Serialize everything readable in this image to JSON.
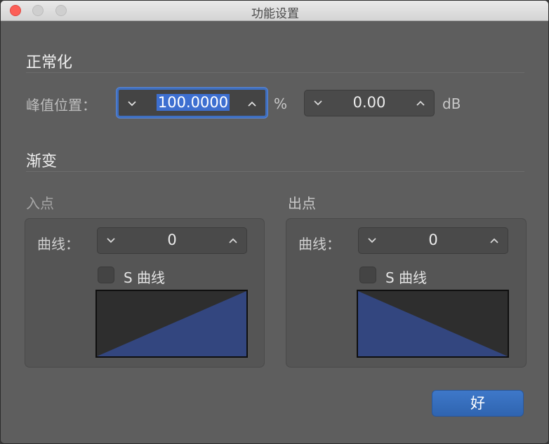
{
  "window": {
    "title": "功能设置"
  },
  "normalize": {
    "section_title": "正常化",
    "peak_label": "峰值位置：",
    "peak_percent_value": "100.0000",
    "percent_unit": "%",
    "peak_db_value": "0.00",
    "db_unit": "dB"
  },
  "fade": {
    "section_title": "渐变",
    "fade_in": {
      "title": "入点",
      "curve_label": "曲线：",
      "curve_value": "0",
      "s_curve_label": "S 曲线",
      "s_curve_checked": false
    },
    "fade_out": {
      "title": "出点",
      "curve_label": "曲线：",
      "curve_value": "0",
      "s_curve_label": "S 曲线",
      "s_curve_checked": false
    }
  },
  "buttons": {
    "ok_label": "好"
  },
  "icons": {
    "stepper_down": "chevron-down-icon",
    "stepper_up": "chevron-up-icon"
  },
  "colors": {
    "accent": "#3d6fd0",
    "curve_fill": "#33467f",
    "close": "#fc5f57"
  }
}
